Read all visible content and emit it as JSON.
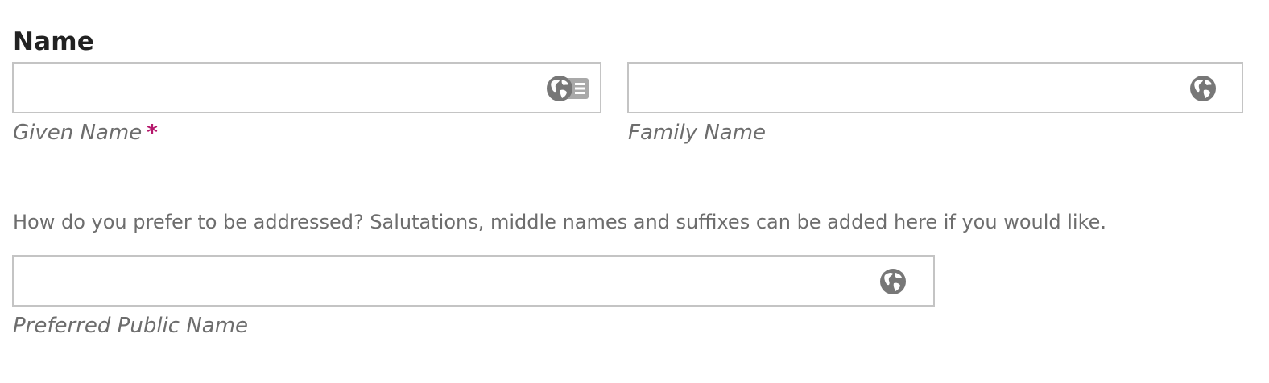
{
  "section": {
    "title": "Name"
  },
  "given_name": {
    "value": "",
    "placeholder": "",
    "label": "Given Name",
    "required_marker": "*",
    "icons": [
      "globe-icon",
      "contact-card-icon"
    ]
  },
  "family_name": {
    "value": "",
    "placeholder": "",
    "label": "Family Name",
    "icons": [
      "globe-icon"
    ]
  },
  "preferred_name": {
    "description": "How do you prefer to be addressed? Salutations, middle names and suffixes can be added here if you would like.",
    "value": "",
    "placeholder": "",
    "label": "Preferred Public Name",
    "icons": [
      "globe-icon"
    ]
  },
  "colors": {
    "required": "#b5176b",
    "label_text": "#6d6d6d",
    "field_border": "#c4c4c4",
    "icon": "#777777"
  }
}
